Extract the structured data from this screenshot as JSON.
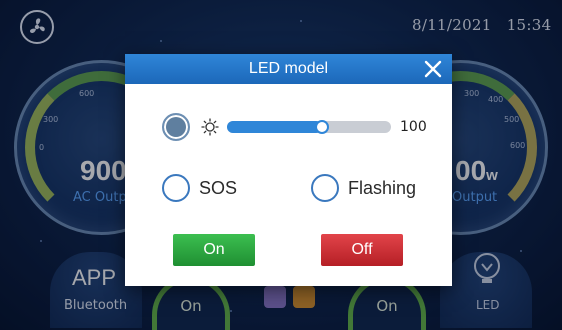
{
  "device": {
    "date": "8/11/2021",
    "time": "15:34",
    "left_gauge": {
      "value": "900",
      "label": "AC Output",
      "ticks": [
        "0",
        "300",
        "600"
      ]
    },
    "right_gauge": {
      "value": "00",
      "unit": "w",
      "label": "Output",
      "ticks": [
        "300",
        "400",
        "500",
        "600"
      ]
    },
    "app_label": "APP",
    "bluetooth_label": "Bluetooth",
    "led_label": "LED",
    "left_round_button": "On",
    "right_round_button": "On",
    "colors": {
      "background": "#10264d",
      "swatch_purple": "#8c78c9",
      "swatch_orange": "#d9932f"
    }
  },
  "modal": {
    "title": "LED model",
    "brightness": {
      "value": 100,
      "display": "100",
      "slider_fraction": 0.58
    },
    "options": [
      {
        "label": "SOS",
        "selected": false
      },
      {
        "label": "Flashing",
        "selected": false
      }
    ],
    "brightness_selected": true,
    "on_button": "On",
    "off_button": "Off",
    "colors": {
      "header": "#1f6fc1",
      "on_button": "#2aa63e",
      "off_button": "#cc2b31",
      "slider_fill": "#2f86d8"
    }
  }
}
